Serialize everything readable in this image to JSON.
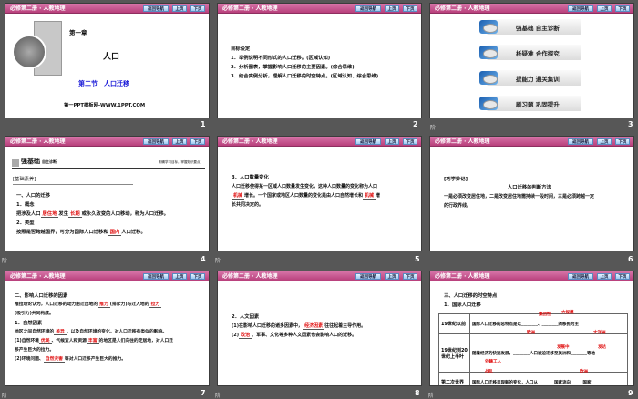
{
  "header": {
    "title": "必修第二册 · 人教地理",
    "nav_back": "返回导航",
    "prev": "上页",
    "next": "下页"
  },
  "slides": [
    {
      "number": "1",
      "chapter": "第一章",
      "title": "人口",
      "section": "第二节　人口迁移",
      "footer": "第一PPT模板网-WWW.1PPT.COM"
    },
    {
      "number": "2",
      "heading": "目标设定",
      "items": [
        "1．举例说明不同形式的人口迁移。(区域认知)",
        "2．分析图表，掌握影响人口迁移的主要因素。(综合思维)",
        "3．结合实例分析，理解人口迁移的时空特点。(区域认知、综合思维)"
      ]
    },
    {
      "number": "3",
      "menu": [
        "强基础 自主诊断",
        "析疑难 合作探究",
        "提能力 通关集训",
        "刷习题 巩固提升"
      ]
    },
    {
      "number": "4",
      "banner": "强基础",
      "banner_sub": "自主诊断",
      "banner_right": "明确学习目标，掌握知识要点",
      "box": "[基础素养]",
      "l1": "一、人口的迁移",
      "l2": "1．概念",
      "l3a": "把涉及人口",
      "f1": "居住地",
      "l3b": "发生",
      "f2": "长期",
      "l3c": "或永久改变的人口移动，称为人口迁移。",
      "l4": "2．类型",
      "l5a": "按照是否跨越国界，可分为国际人口迁移和",
      "f3": "国内",
      "l5b": "人口迁移。"
    },
    {
      "number": "5",
      "l1": "3．人口数量变化",
      "l2": "人口迁移使得某一区域人口数量发生变化，这种人口数量的变化称为人口",
      "f1": "机械",
      "l3a": "增长。一个国家或地区人口数量的变化是由人口自然增长和",
      "f2": "机械",
      "l3b": "增",
      "l4": "长共同决定的。"
    },
    {
      "number": "6",
      "l1": "[巧学妙记]",
      "l2": "人口迁移的判断方法",
      "l3": "一是必须改变居住地，二是改变居住地需持续一段时间，三是必须跨越一定",
      "l4": "的行政界线。"
    },
    {
      "number": "7",
      "l1": "二、影响人口迁移的因素",
      "l2a": "推拉理论认为，人口迁移的动力由迁出地的",
      "f1": "推力",
      "l2b": "(排斥力)与迁入地的",
      "f2": "拉力",
      "l3": "(吸引力)共同构成。",
      "l4": "1．自然因素",
      "l5a": "地区之间自然环境的",
      "f3": "差异",
      "l5b": "，以及自然环境的变化，对人口迁移有类似的影响。",
      "l6a": "(1)自然环境",
      "f4": "优美",
      "l6b": "、气候宜人和资源",
      "f5": "丰富",
      "l6c": "的地区是人们向往的定居地，对人口迁",
      "l7": "移产生巨大的拉力。",
      "l8a": "(2)环境问题、",
      "f6": "自然灾害",
      "l8b": "等对人口迁移产生巨大的推力。"
    },
    {
      "number": "8",
      "l1": "2．人文因素",
      "l2a": "(1)在影响人口迁移的诸多因素中，",
      "f1": "经济因素",
      "l2b": "往往起着主导作用。",
      "l3a": "(2)",
      "f2": "政治",
      "l3b": "、军事、文化等多种人文因素也会影响人口的迁移。"
    },
    {
      "number": "9",
      "l1": "三、人口迁移的时空特点",
      "l2": "1．国际人口迁移",
      "rows": [
        {
          "period": "19世纪以前",
          "text": "国际人口迁移的总特点是以________、________的移民为主",
          "answers": [
            "集团性",
            "大规模",
            "欧洲",
            "大洋洲"
          ]
        },
        {
          "period": "19世纪到20世纪上半叶",
          "text": "随着经济的快速发展，________人口被迫迁移至美洲和________等地",
          "answers": [
            "发展中",
            "发达",
            "外籍工人",
            "战乱",
            "欧洲"
          ]
        },
        {
          "period": "第二次世界",
          "text": "国际人口迁移呈现新的变化，人口从________国家流向______国家"
        }
      ]
    }
  ],
  "side_label": "阶"
}
